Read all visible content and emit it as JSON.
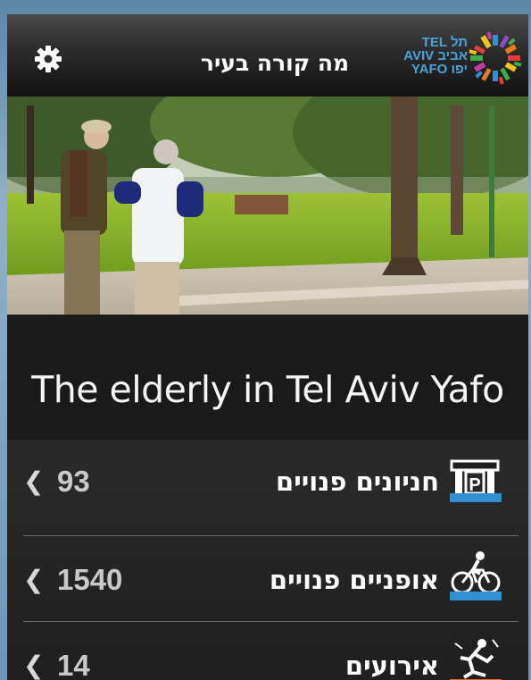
{
  "header": {
    "title": "מה קורה בעיר",
    "settings_icon": "gear-icon",
    "logo": {
      "line1": "TEL תל",
      "line2": "AVIV אביב",
      "line3": "YAFO יפו"
    }
  },
  "hero": {
    "caption": "The elderly in Tel Aviv Yafo"
  },
  "list": {
    "items": [
      {
        "label": "חניונים פנויים",
        "count": "93",
        "icon": "parking-icon",
        "accent": "#2f8fd0"
      },
      {
        "label": "אופניים פנויים",
        "count": "1540",
        "icon": "bicycle-icon",
        "accent": "#2f8fd0"
      },
      {
        "label": "אירועים",
        "count": "14",
        "icon": "events-icon",
        "accent": "#e0622c"
      }
    ]
  }
}
